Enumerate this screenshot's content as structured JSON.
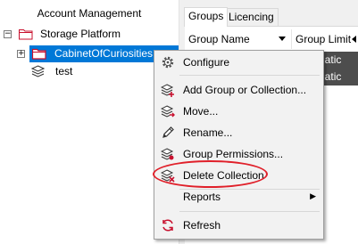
{
  "left_panel": {
    "title": "Account Management",
    "tree": {
      "root": {
        "label": "Storage Platform",
        "expander": "−"
      },
      "selected": {
        "label": "CabinetOfCuriosities",
        "expander": "+"
      },
      "child": {
        "label": "test"
      }
    }
  },
  "right_panel": {
    "tabs": [
      "Groups",
      "Licencing"
    ],
    "columns": {
      "group_name": "Group Name",
      "group_limit": "Group Limit"
    },
    "rows": [
      {
        "limit": "Automatic"
      },
      {
        "limit": "Automatic"
      }
    ]
  },
  "context_menu": {
    "items": [
      {
        "label": "Configure",
        "icon": "gear-icon"
      },
      {
        "label": "Add Group or Collection...",
        "icon": "add-layers-icon"
      },
      {
        "label": "Move...",
        "icon": "move-layers-icon"
      },
      {
        "label": "Rename...",
        "icon": "pencil-icon"
      },
      {
        "label": "Group Permissions...",
        "icon": "permissions-icon"
      },
      {
        "label": "Delete Collection",
        "icon": "delete-layers-icon"
      },
      {
        "label": "Reports",
        "icon": "reports-icon"
      },
      {
        "label": "Refresh",
        "icon": "refresh-icon"
      }
    ]
  },
  "colors": {
    "selection": "#0078d7",
    "highlight": "#e0202a",
    "folder": "#c8102e",
    "menu_bg": "#f2f2f2"
  }
}
